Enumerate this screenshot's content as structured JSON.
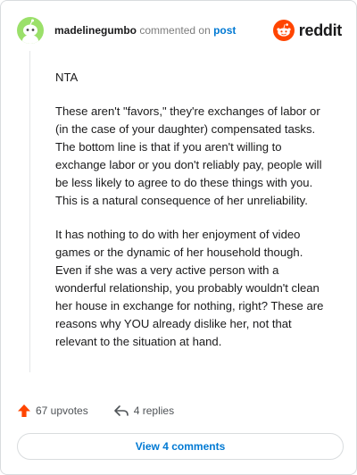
{
  "header": {
    "username": "madelinegumbo",
    "commented_on": "commented on",
    "post_link": "post",
    "brand": "reddit",
    "brand_color": "#ff4500",
    "avatar_icon": "snoo-avatar-icon"
  },
  "comment": {
    "paragraphs": [
      "NTA",
      "These aren't \"favors,\" they're exchanges of labor or (in the case of your daughter) compensated tasks. The bottom line is that if you aren't willing to exchange labor or you don't reliably pay, people will be less likely to agree to do these things with you. This is a natural consequence of her unreliability.",
      "It has nothing to do with her enjoyment of video games or the dynamic of her household though. Even if she was a very active person with a wonderful relationship, you probably wouldn't clean her house in exchange for nothing, right? These are reasons why YOU already dislike her, not that relevant to the situation at hand."
    ]
  },
  "actions": {
    "upvotes": "67 upvotes",
    "upvote_icon": "upvote-arrow-icon",
    "replies": "4 replies",
    "reply_icon": "reply-arrow-icon"
  },
  "footer": {
    "view_comments": "View 4 comments"
  }
}
